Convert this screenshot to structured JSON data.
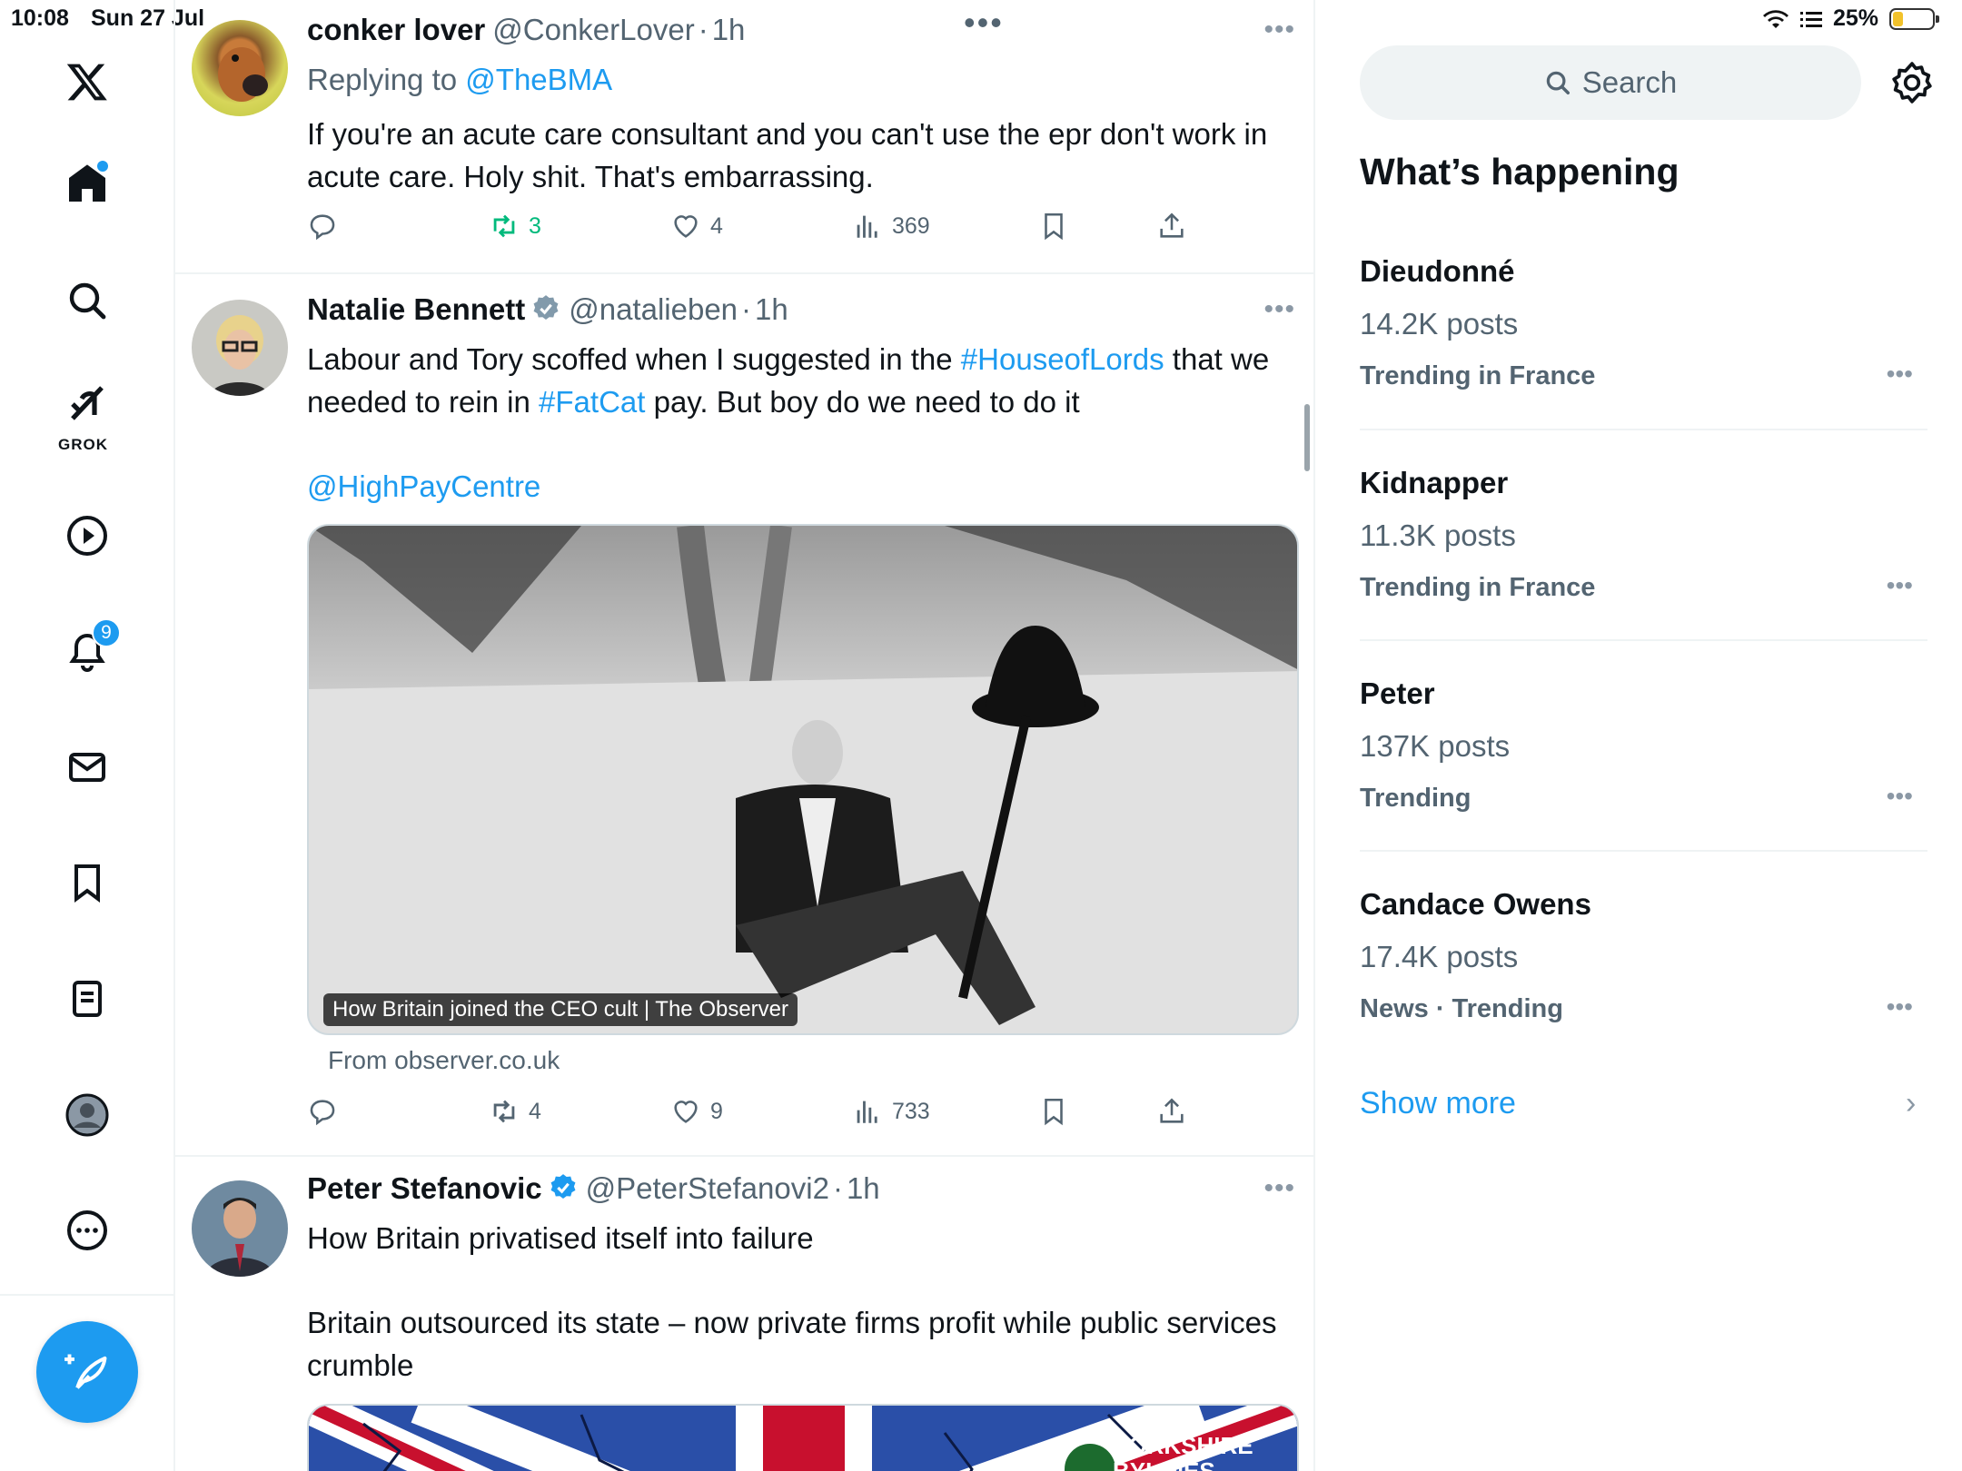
{
  "status": {
    "time": "10:08",
    "date": "Sun 27 Jul",
    "battery": "25%",
    "battery_level": 0.25
  },
  "nav": {
    "grok_label": "GROK",
    "notifications_badge": "9"
  },
  "timeline": {
    "tweets": [
      {
        "name": "conker lover",
        "handle": "@ConkerLover",
        "time": "1h",
        "replying_prefix": "Replying to",
        "replying_to": "@TheBMA",
        "text": "If you're an acute care consultant and you can't use the epr don't work in acute care. Holy shit. That's embarrassing.",
        "retweets": "3",
        "likes": "4",
        "views": "369"
      },
      {
        "name": "Natalie Bennett",
        "handle": "@natalieben",
        "time": "1h",
        "text_1": "Labour and Tory scoffed when I suggested in the",
        "hashtag_1": "#HouseofLords",
        "text_2": "that we needed to rein in",
        "hashtag_2": "#FatCat",
        "text_3": "pay. But boy do we need to do it",
        "mention": "@HighPayCentre",
        "card_caption": "How Britain joined the CEO cult | The Observer",
        "card_source": "From observer.co.uk",
        "retweets": "4",
        "likes": "9",
        "views": "733"
      },
      {
        "name": "Peter Stefanovic",
        "handle": "@PeterStefanovi2",
        "time": "1h",
        "line_1": "How Britain privatised itself into failure",
        "line_2": "Britain outsourced its state – now private firms profit while public services crumble",
        "image_text": "YORKSHIRE BYLINES"
      }
    ]
  },
  "sidebar": {
    "search_placeholder": "Search",
    "title": "What’s happening",
    "trends": [
      {
        "name": "Dieudonné",
        "posts": "14.2K posts",
        "context": "Trending in France"
      },
      {
        "name": "Kidnapper",
        "posts": "11.3K posts",
        "context": "Trending in France"
      },
      {
        "name": "Peter",
        "posts": "137K posts",
        "context": "Trending"
      },
      {
        "name": "Candace Owens",
        "posts": "17.4K posts",
        "context": "News · Trending"
      }
    ],
    "show_more": "Show more"
  },
  "colors": {
    "accent": "#1d9bf0",
    "retweet_active": "#00ba7c",
    "muted": "#536471"
  }
}
